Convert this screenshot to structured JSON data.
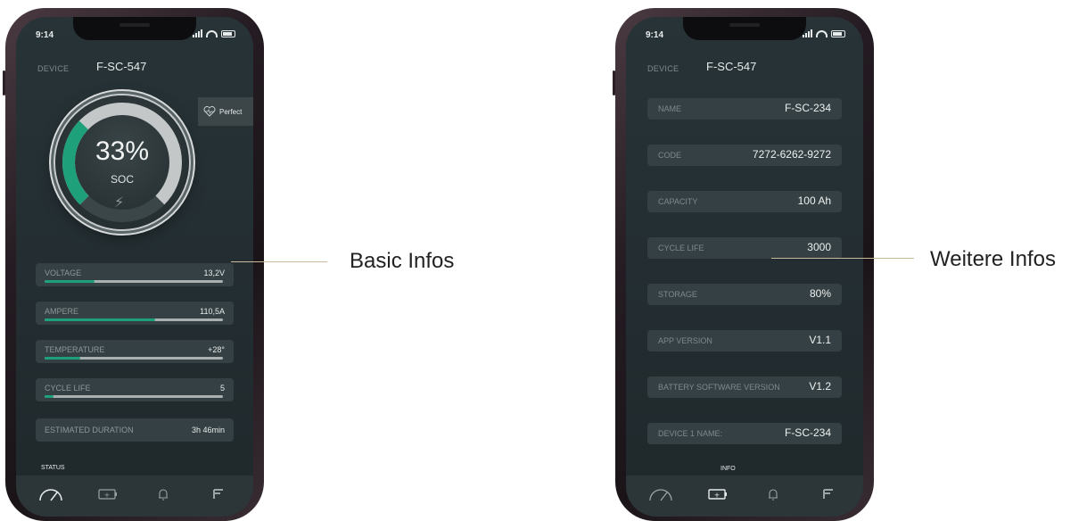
{
  "status": {
    "time": "9:14"
  },
  "device": {
    "label": "DEVICE",
    "id": "F-SC-547"
  },
  "left_screen": {
    "soc_value": "33%",
    "soc_label": "SOC",
    "soc_fraction": 0.33,
    "health": "Perfect",
    "rows": [
      {
        "label": "VOLTAGE",
        "value": "13,2V",
        "level": 0.28
      },
      {
        "label": "AMPERE",
        "value": "110,5A",
        "level": 0.62
      },
      {
        "label": "TEMPERATURE",
        "value": "+28°",
        "level": 0.2
      },
      {
        "label": "CYCLE LIFE",
        "value": "5",
        "level": 0.05
      },
      {
        "label": "ESTIMATED DURATION",
        "value": "3h 46min"
      }
    ],
    "section_label": "STATUS"
  },
  "right_screen": {
    "rows": [
      {
        "label": "NAME",
        "value": "F-SC-234"
      },
      {
        "label": "CODE",
        "value": "7272-6262-9272"
      },
      {
        "label": "CAPACITY",
        "value": "100 Ah"
      },
      {
        "label": "CYCLE LIFE",
        "value": "3000"
      },
      {
        "label": "STORAGE",
        "value": "80%"
      },
      {
        "label": "APP VERSION",
        "value": "V1.1"
      },
      {
        "label": "BATTERY SOFTWARE VERSION",
        "value": "V1.2"
      },
      {
        "label": "DEVICE 1 NAME:",
        "value": "F-SC-234"
      }
    ],
    "section_label": "INFO"
  },
  "tabs": [
    {
      "icon": "speedometer-icon"
    },
    {
      "icon": "battery-icon"
    },
    {
      "icon": "bell-icon"
    },
    {
      "icon": "brand-logo-icon"
    }
  ],
  "callouts": {
    "left": "Basic Infos",
    "right": "Weitere Infos"
  },
  "colors": {
    "accent": "#1ea07a",
    "screen_bg": "#273337",
    "row_bg": "#344043"
  }
}
